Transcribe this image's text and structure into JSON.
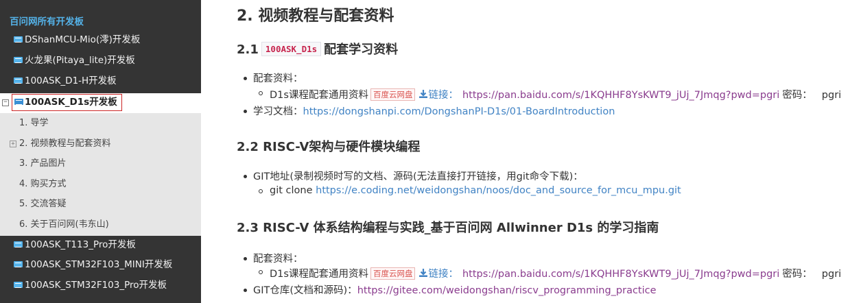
{
  "sidebar": {
    "heading": "百问网所有开发板",
    "items_top": [
      {
        "label": "DShanMCU-Mio(澪)开发板"
      },
      {
        "label": "火龙果(Pitaya_lite)开发板"
      },
      {
        "label": "100ASK_D1-H开发板"
      }
    ],
    "active": {
      "label": "100ASK_D1s开发板",
      "toggle": "⊟"
    },
    "subitems": [
      {
        "label": "1. 导学"
      },
      {
        "label": "2. 视频教程与配套资料",
        "toggle": "⊞"
      },
      {
        "label": "3. 产品图片"
      },
      {
        "label": "4. 购买方式"
      },
      {
        "label": "5. 交流答疑"
      },
      {
        "label": "6. 关于百问网(韦东山)"
      }
    ],
    "items_bottom": [
      {
        "label": "100ASK_T113_Pro开发板"
      },
      {
        "label": "100ASK_STM32F103_MINI开发板"
      },
      {
        "label": "100ASK_STM32F103_Pro开发板"
      }
    ]
  },
  "main": {
    "title": "2. 视频教程与配套资料",
    "s21": {
      "num": "2.1",
      "code": "100ASK_D1s",
      "title": "配套学习资料",
      "item1_label": "配套资料：",
      "sub1_prefix": "D1s课程配套通用资料",
      "sub1_tag": "百度云网盘",
      "sub1_link_label": "链接：",
      "sub1_url": "https://pan.baidu.com/s/1KQHHF8YsKWT9_jUj_7Jmqg?pwd=pgri",
      "sub1_pwd_label": "密码：",
      "sub1_pwd": "pgri",
      "item2_label": "学习文档：",
      "item2_url": "https://dongshanpi.com/DongshanPI-D1s/01-BoardIntroduction"
    },
    "s22": {
      "title": "2.2 RISC-V架构与硬件模块编程",
      "item1": "GIT地址(录制视频时写的文档、源码(无法直接打开链接，用git命令下载)：",
      "sub1_prefix": "git clone",
      "sub1_url": "https://e.coding.net/weidongshan/noos/doc_and_source_for_mcu_mpu.git"
    },
    "s23": {
      "title": "2.3 RISC-V 体系结构编程与实践_基于百问网 Allwinner D1s 的学习指南",
      "item1_label": "配套资料：",
      "sub1_prefix": "D1s课程配套通用资料",
      "sub1_tag": "百度云网盘",
      "sub1_link_label": "链接：",
      "sub1_url": "https://pan.baidu.com/s/1KQHHF8YsKWT9_jUj_7Jmqg?pwd=pgri",
      "sub1_pwd_label": "密码：",
      "sub1_pwd": "pgri",
      "item2_label": "GIT仓库(文档和源码)：",
      "item2_url": "https://gitee.com/weidongshan/riscv_programming_practice"
    }
  },
  "colors": {
    "sidebar_bg": "#343434",
    "sidebar_heading": "#54b2e8",
    "active_border": "#cc2525",
    "link": "#4183c4",
    "visited_link": "#8a3c8e",
    "code": "#c7254e"
  }
}
